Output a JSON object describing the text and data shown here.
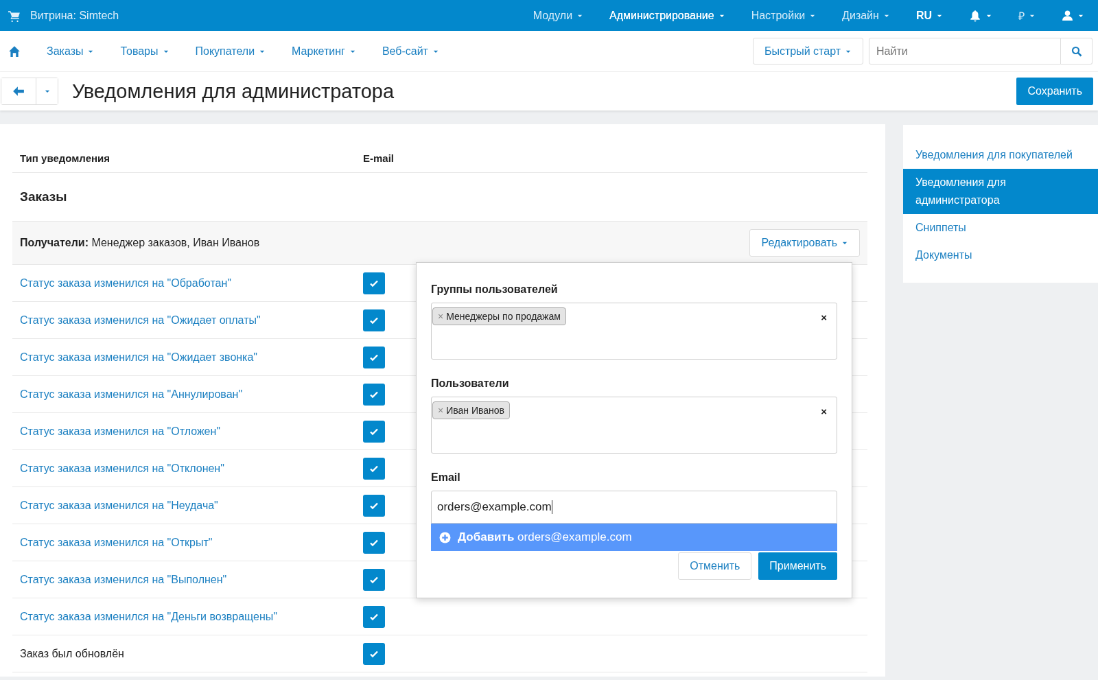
{
  "top_bar": {
    "store": "Витрина: Simtech",
    "menus": [
      {
        "label": "Модули",
        "active": false,
        "kind": "menu"
      },
      {
        "label": "Администрирование",
        "active": true,
        "kind": "menu"
      },
      {
        "label": "Настройки",
        "active": false,
        "kind": "menu"
      },
      {
        "label": "Дизайн",
        "active": false,
        "kind": "menu"
      },
      {
        "label": "RU",
        "active": false,
        "kind": "language"
      }
    ],
    "currency": "₽"
  },
  "nav": {
    "items": [
      "Заказы",
      "Товары",
      "Покупатели",
      "Маркетинг",
      "Веб-сайт"
    ],
    "quick_start": "Быстрый старт",
    "search": {
      "placeholder": "Найти"
    }
  },
  "page": {
    "title": "Уведомления для администратора",
    "save": "Сохранить"
  },
  "table": {
    "columns": [
      "Тип уведомления",
      "E-mail"
    ],
    "section": "Заказы",
    "recipients": "**Получатели:** Менеджер заказов, Иван Иванов",
    "edit_button": "Редактировать",
    "rows": [
      {
        "label": "Статус заказа изменился на \"Обработан\"",
        "kind": "link",
        "checked": true
      },
      {
        "label": "Статус заказа изменился на \"Ожидает оплаты\"",
        "kind": "link",
        "checked": true
      },
      {
        "label": "Статус заказа изменился на \"Ожидает звонка\"",
        "kind": "link",
        "checked": true
      },
      {
        "label": "Статус заказа изменился на \"Аннулирован\"",
        "kind": "link",
        "checked": true
      },
      {
        "label": "Статус заказа изменился на \"Отложен\"",
        "kind": "link",
        "checked": true
      },
      {
        "label": "Статус заказа изменился на \"Отклонен\"",
        "kind": "link",
        "checked": true
      },
      {
        "label": "Статус заказа изменился на \"Неудача\"",
        "kind": "link",
        "checked": true
      },
      {
        "label": "Статус заказа изменился на \"Открыт\"",
        "kind": "link",
        "checked": true
      },
      {
        "label": "Статус заказа изменился на \"Выполнен\"",
        "kind": "link",
        "checked": true
      },
      {
        "label": "Статус заказа изменился на \"Деньги возвращены\"",
        "kind": "link",
        "checked": true
      },
      {
        "label": "Заказ был обновлён",
        "kind": "text",
        "checked": true
      }
    ]
  },
  "popover": {
    "groups_label": "Группы пользователей",
    "groups": [
      {
        "remove": "×",
        "label": "Менеджеры по продажам"
      }
    ],
    "groups_clear": "×",
    "users_label": "Пользователи",
    "users": [
      {
        "remove": "×",
        "label": "Иван Иванов"
      }
    ],
    "users_clear": "×",
    "email_label": "Email",
    "email_value": "orders@example.com",
    "suggestion": "**Добавить** orders@example.com",
    "cancel": "Отменить",
    "apply": "Применить"
  },
  "sidebar": {
    "items": [
      {
        "label": "Уведомления для покупателей",
        "selected": false
      },
      {
        "label": "Уведомления для администратора",
        "selected": true
      },
      {
        "label": "Сниппеты",
        "selected": false
      },
      {
        "label": "Документы",
        "selected": false
      }
    ]
  }
}
